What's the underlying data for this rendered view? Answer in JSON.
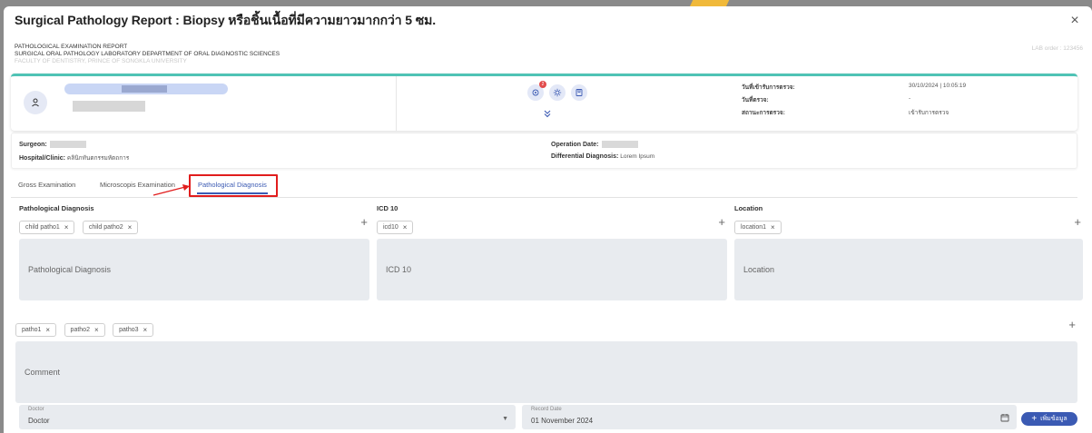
{
  "modal": {
    "title": "Surgical Pathology Report : Biopsy หรือชิ้นเนื้อที่มีความยาวมากกว่า 5 ซม.",
    "close_glyph": "×"
  },
  "report_head": {
    "line1": "PATHOLOGICAL EXAMINATION REPORT",
    "line2": "SURGICAL ORAL PATHOLOGY LABORATORY DEPARTMENT OF ORAL DIAGNOSTIC SCIENCES",
    "line3": "FACULTY OF DENTISTRY, PRINCE OF SONGKLA UNIVERSITY",
    "lab_order": "LAB order : 123456"
  },
  "patient": {
    "avatar_icon": "user-icon",
    "action_icons": [
      "virus-icon",
      "settings-icon",
      "document-icon"
    ],
    "badge_count": "2",
    "info": [
      {
        "label": "วันที่เข้ารับการตรวจ:",
        "value": "30/10/2024 | 10:05:19"
      },
      {
        "label": "วันที่ตรวจ:",
        "value": "-"
      },
      {
        "label": "สถานะการตรวจ:",
        "value": "เข้ารับการตรวจ"
      }
    ]
  },
  "surgery": {
    "surgeon_label": "Surgeon:",
    "hospital_label": "Hospital/Clinic:",
    "hospital_value": "คลินิกทันตกรรมหัตถการ",
    "operation_date_label": "Operation Date:",
    "differential_label": "Differential Diagnosis:",
    "differential_value": "Lorem Ipsum"
  },
  "tabs": [
    {
      "label": "Gross Examination"
    },
    {
      "label": "Microscopis Examination"
    },
    {
      "label": "Pathological Diagnosis",
      "active": true
    }
  ],
  "columns": [
    {
      "title": "Pathological Diagnosis",
      "chips": [
        "child patho1",
        "child patho2"
      ],
      "placeholder": "Pathological Diagnosis"
    },
    {
      "title": "ICD 10",
      "chips": [
        "icd10"
      ],
      "placeholder": "ICD 10"
    },
    {
      "title": "Location",
      "chips": [
        "location1"
      ],
      "placeholder": "Location"
    }
  ],
  "comment": {
    "chips": [
      "patho1",
      "patho2",
      "patho3"
    ],
    "placeholder": "Comment"
  },
  "doctor": {
    "label": "Doctor",
    "value": "Doctor"
  },
  "record_date": {
    "label": "Record Date",
    "value": "01 November 2024"
  },
  "add_button": {
    "label": "เพิ่มข้อมูล"
  },
  "colors": {
    "accent_teal": "#4fc3b5",
    "primary_blue": "#3b5ab3",
    "highlight_red": "#e11d1d",
    "field_bg": "#e8ebef"
  }
}
